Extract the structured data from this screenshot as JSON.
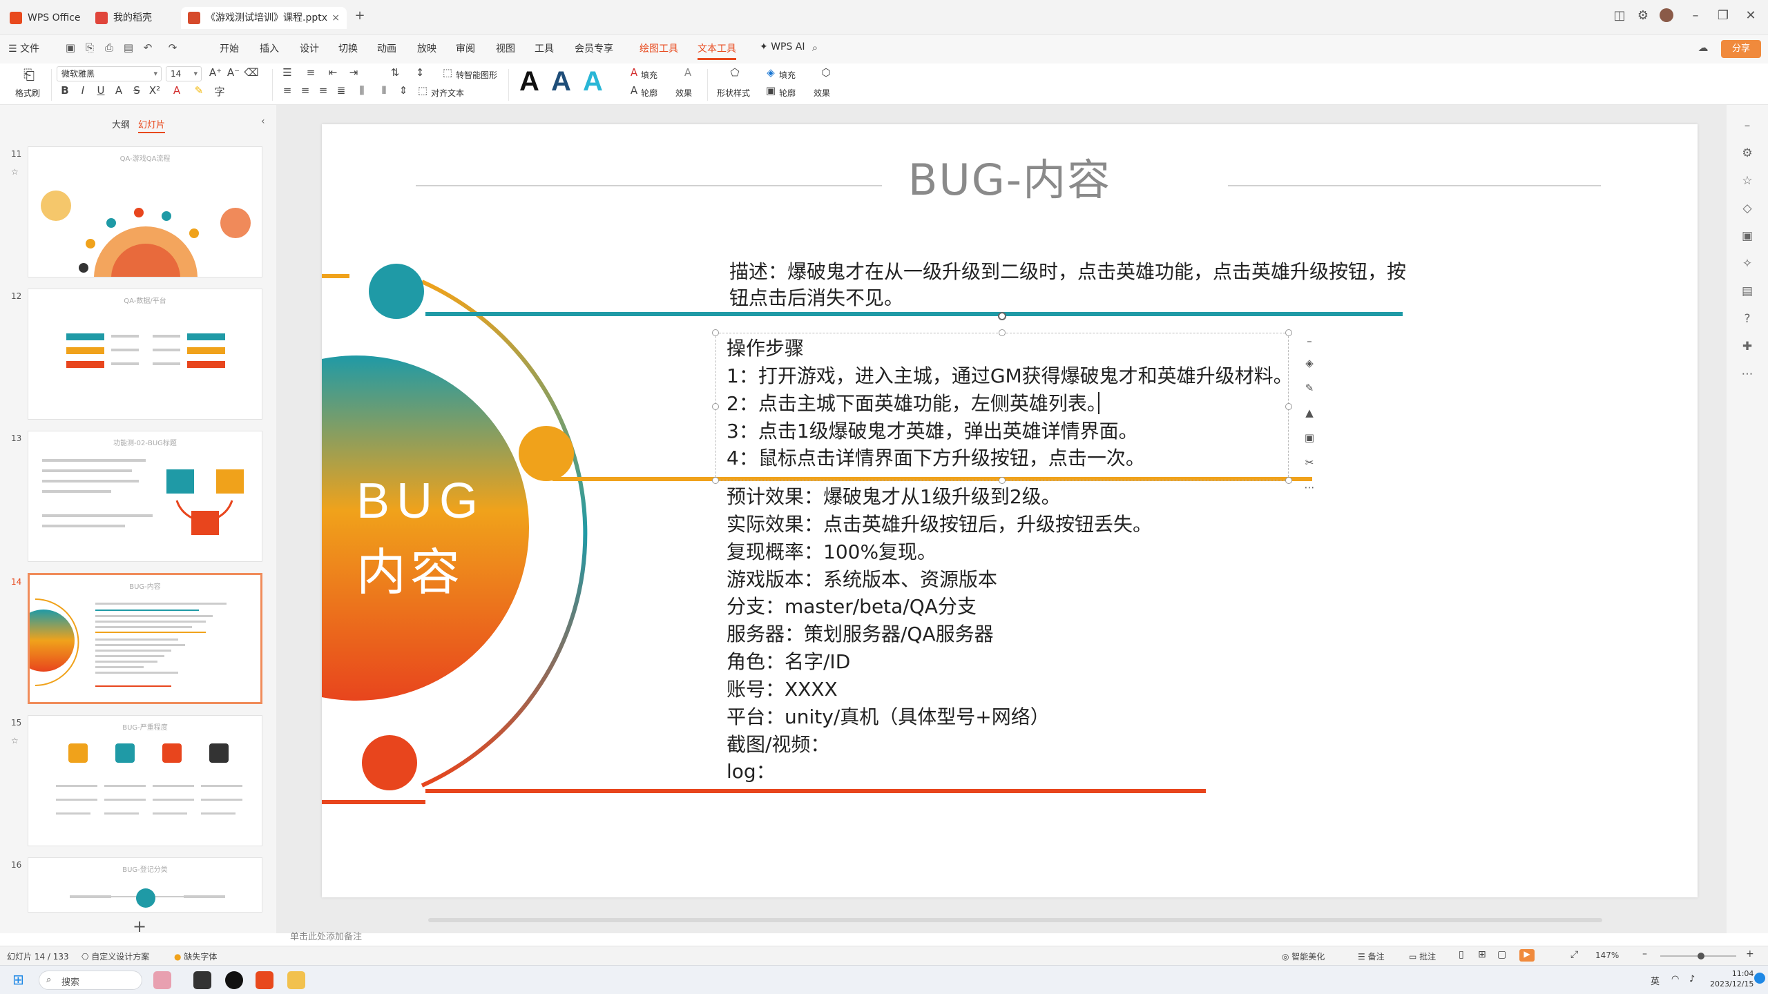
{
  "titlebar": {
    "tabs": [
      {
        "label": "WPS Office",
        "icon": "wps-logo-icon"
      },
      {
        "label": "我的稻壳",
        "icon": "docer-icon"
      },
      {
        "label": "《游戏测试培训》课程.pptx",
        "icon": "pptx-file-icon"
      }
    ],
    "new_tab": "+"
  },
  "menu": {
    "file": "文件",
    "items": [
      "开始",
      "插入",
      "设计",
      "切换",
      "动画",
      "放映",
      "审阅",
      "视图",
      "工具",
      "会员专享"
    ],
    "drawing_tools": "绘图工具",
    "text_tools": "文本工具",
    "wps_ai": "WPS AI",
    "share": "分享"
  },
  "ribbon": {
    "format_painter": "格式刷",
    "font_family": "微软雅黑",
    "font_size": "14",
    "smart_shape": "转智能图形",
    "align_text": "对齐文本",
    "fill": "填充",
    "outline": "轮廓",
    "effect": "效果",
    "shape_style": "形状样式",
    "shape_fill": "填充",
    "shape_outline": "轮廓",
    "shape_effect": "效果",
    "text_styles": [
      "A",
      "A",
      "A"
    ]
  },
  "left_panel": {
    "tabs": [
      "大纲",
      "幻灯片"
    ],
    "slides": [
      {
        "number": "11",
        "title": "QA-游戏QA流程"
      },
      {
        "number": "12",
        "title": "QA-数据/平台"
      },
      {
        "number": "13",
        "title": "功能测-02-BUG标题"
      },
      {
        "number": "14",
        "title": "BUG-内容"
      },
      {
        "number": "15",
        "title": "BUG-严重程度"
      },
      {
        "number": "16",
        "title": "BUG-登记分类"
      }
    ],
    "add_slide": "+"
  },
  "slide": {
    "title": "BUG-内容",
    "badge_line1": "BUG",
    "badge_line2": "内容",
    "description": "描述：爆破鬼才在从一级升级到二级时，点击英雄功能，点击英雄升级按钮，按钮点击后消失不见。",
    "steps_heading": "操作步骤",
    "steps": [
      "1：打开游戏，进入主城，通过GM获得爆破鬼才和英雄升级材料。",
      "2：点击主城下面英雄功能，左侧英雄列表。",
      "3：点击1级爆破鬼才英雄，弹出英雄详情界面。",
      "4：鼠标点击详情界面下方升级按钮，点击一次。"
    ],
    "details": [
      "预计效果：爆破鬼才从1级升级到2级。",
      "实际效果：点击英雄升级按钮后，升级按钮丢失。",
      "复现概率：100%复现。",
      "游戏版本：系统版本、资源版本",
      "分支：master/beta/QA分支",
      "服务器：策划服务器/QA服务器",
      "角色：名字/ID",
      "账号：XXXX",
      "平台：unity/真机（具体型号+网络）",
      "截图/视频：",
      "log："
    ]
  },
  "notes_placeholder": "单击此处添加备注",
  "statusbar": {
    "slide_pos": "幻灯片 14 / 133",
    "design": "自定义设计方案",
    "missing_font": "缺失字体",
    "beautify": "智能美化",
    "notes": "备注",
    "comments": "批注",
    "zoom": "147%"
  },
  "taskbar": {
    "search": "搜索",
    "time": "11:04",
    "date": "2023/12/15",
    "ime": "英"
  },
  "colors": {
    "teal": "#1f9aa6",
    "orange": "#f0a21b",
    "red": "#e8451d",
    "accent": "#e8491d"
  }
}
